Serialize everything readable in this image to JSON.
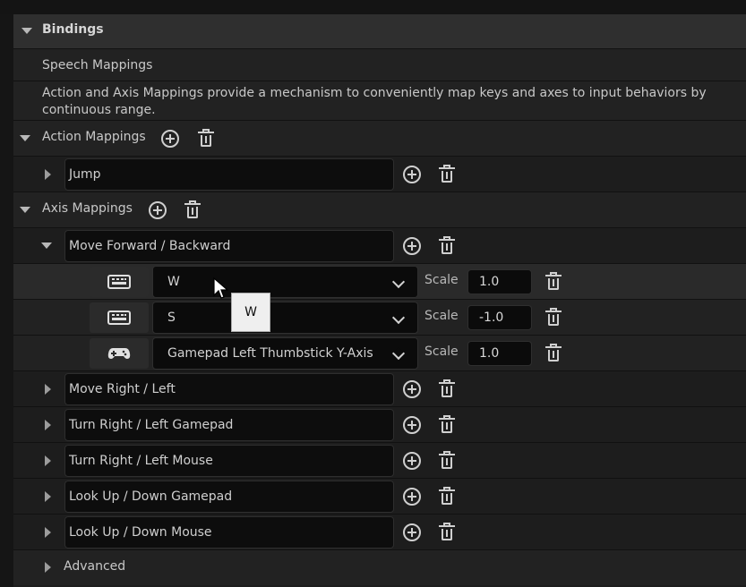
{
  "bindings_header": "Bindings",
  "speech_mappings": "Speech Mappings",
  "description_line1": "Action and Axis Mappings provide a mechanism to conveniently map keys and axes to input behaviors by",
  "description_line2": "continuous range.",
  "action_mappings": {
    "label": "Action Mappings",
    "items": [
      {
        "name": "Jump"
      }
    ]
  },
  "axis_mappings": {
    "label": "Axis Mappings",
    "expanded": {
      "name": "Move Forward / Backward",
      "keys": [
        {
          "device": "keyboard-icon",
          "key": "W",
          "scale_label": "Scale",
          "scale": "1.0"
        },
        {
          "device": "keyboard-icon",
          "key": "S",
          "scale_label": "Scale",
          "scale": "-1.0"
        },
        {
          "device": "gamepad-icon",
          "key": "Gamepad Left Thumbstick Y-Axis",
          "scale_label": "Scale",
          "scale": "1.0"
        }
      ]
    },
    "collapsed": [
      {
        "name": "Move Right / Left"
      },
      {
        "name": "Turn Right / Left Gamepad"
      },
      {
        "name": "Turn Right / Left Mouse"
      },
      {
        "name": "Look Up / Down Gamepad"
      },
      {
        "name": "Look Up / Down Mouse"
      }
    ]
  },
  "advanced": "Advanced",
  "tooltip": "W"
}
